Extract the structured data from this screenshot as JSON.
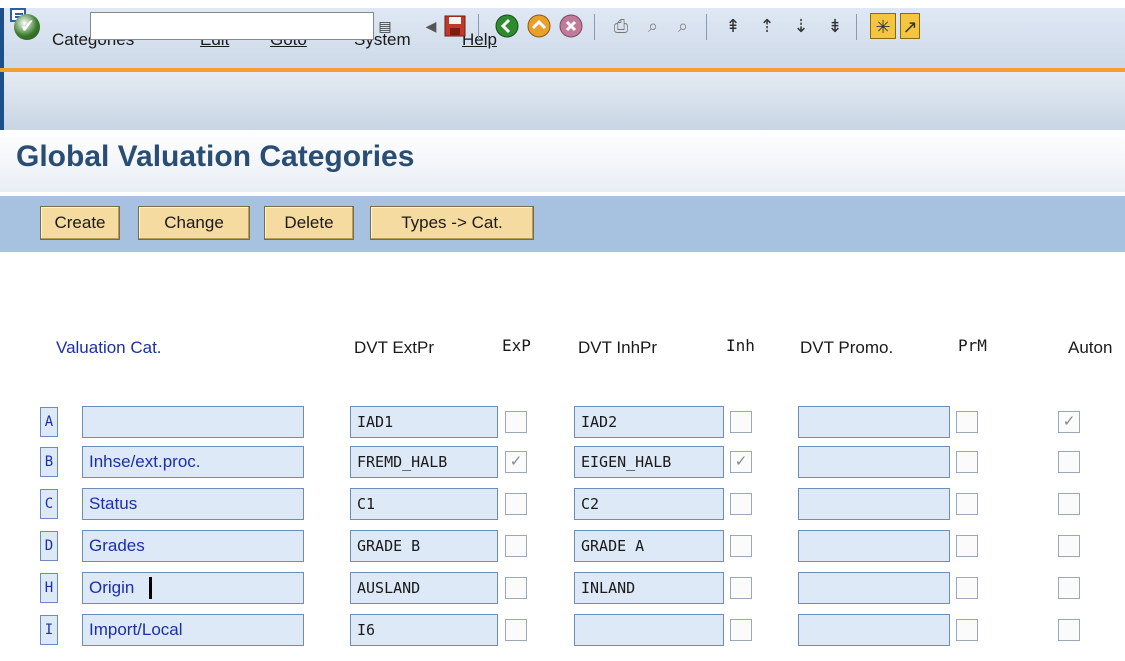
{
  "menu": {
    "items": [
      "Categories",
      "Edit",
      "Goto",
      "System",
      "Help"
    ]
  },
  "toolbar": {
    "command_value": "",
    "icons": [
      "ok-icon",
      "command-dropdown-icon",
      "back-arrow-icon",
      "save-icon",
      "back-icon",
      "exit-icon",
      "cancel-icon",
      "print-icon",
      "find-icon",
      "find-next-icon",
      "first-page-icon",
      "previous-page-icon",
      "next-page-icon",
      "last-page-icon",
      "new-session-icon",
      "shortcut-icon"
    ]
  },
  "page": {
    "title": "Global Valuation Categories"
  },
  "app_buttons": [
    "Create",
    "Change",
    "Delete",
    "Types -> Cat."
  ],
  "table": {
    "headers": {
      "valuation_cat": "Valuation Cat.",
      "dvt_extpr": "DVT ExtPr",
      "exp": "ExP",
      "dvt_inhpr": "DVT InhPr",
      "inh": "Inh",
      "dvt_promo": "DVT Promo.",
      "prm": "PrM",
      "auton": "Auton"
    },
    "rows": [
      {
        "key": "A",
        "desc": "",
        "extpr": "IAD1",
        "exp": false,
        "inhpr": "IAD2",
        "inh": false,
        "promo": "",
        "prm": false,
        "auton": true
      },
      {
        "key": "B",
        "desc": "Inhse/ext.proc.",
        "extpr": "FREMD_HALB",
        "exp": true,
        "inhpr": "EIGEN_HALB",
        "inh": true,
        "promo": "",
        "prm": false,
        "auton": false
      },
      {
        "key": "C",
        "desc": "Status",
        "extpr": "C1",
        "exp": false,
        "inhpr": "C2",
        "inh": false,
        "promo": "",
        "prm": false,
        "auton": false
      },
      {
        "key": "D",
        "desc": "Grades",
        "extpr": "GRADE B",
        "exp": false,
        "inhpr": "GRADE A",
        "inh": false,
        "promo": "",
        "prm": false,
        "auton": false
      },
      {
        "key": "H",
        "desc": "Origin",
        "extpr": "AUSLAND",
        "exp": false,
        "inhpr": "INLAND",
        "inh": false,
        "promo": "",
        "prm": false,
        "auton": false
      },
      {
        "key": "I",
        "desc": "Import/Local",
        "extpr": "I6",
        "exp": false,
        "inhpr": "",
        "inh": false,
        "promo": "",
        "prm": false,
        "auton": false
      }
    ]
  }
}
